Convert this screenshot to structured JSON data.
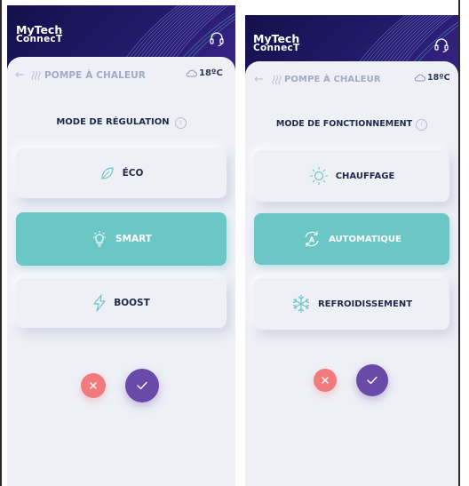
{
  "colors": {
    "header_dark": "#14104a",
    "accent_teal": "#6ac7c6",
    "confirm_purple": "#6a4aa8",
    "cancel_red": "#f07a7c",
    "text_dark": "#1f2a4a"
  },
  "brand": {
    "line1": "MyTech",
    "line2": "ConnecT"
  },
  "left_screen": {
    "breadcrumb": "POMPE À CHALEUR",
    "temperature": "18ºC",
    "section_title": "MODE DE RÉGULATION",
    "options": [
      {
        "label": "ÉCO",
        "icon": "leaf-icon",
        "active": false
      },
      {
        "label": "SMART",
        "icon": "lightbulb-icon",
        "active": true
      },
      {
        "label": "BOOST",
        "icon": "lightning-icon",
        "active": false
      }
    ]
  },
  "right_screen": {
    "breadcrumb": "POMPE À CHALEUR",
    "temperature": "18ºC",
    "section_title": "MODE DE FONCTIONNEMENT",
    "options": [
      {
        "label": "CHAUFFAGE",
        "icon": "sun-icon",
        "active": false
      },
      {
        "label": "AUTOMATIQUE",
        "icon": "auto-cycle-icon",
        "active": true
      },
      {
        "label": "REFROIDISSEMENT",
        "icon": "snowflake-icon",
        "active": false
      }
    ]
  },
  "icons": {
    "back": "back-arrow-icon",
    "support": "headset-icon",
    "weather": "cloud-icon",
    "heat": "heat-waves-icon",
    "info": "info-icon",
    "cancel": "close-icon",
    "confirm": "check-icon"
  }
}
